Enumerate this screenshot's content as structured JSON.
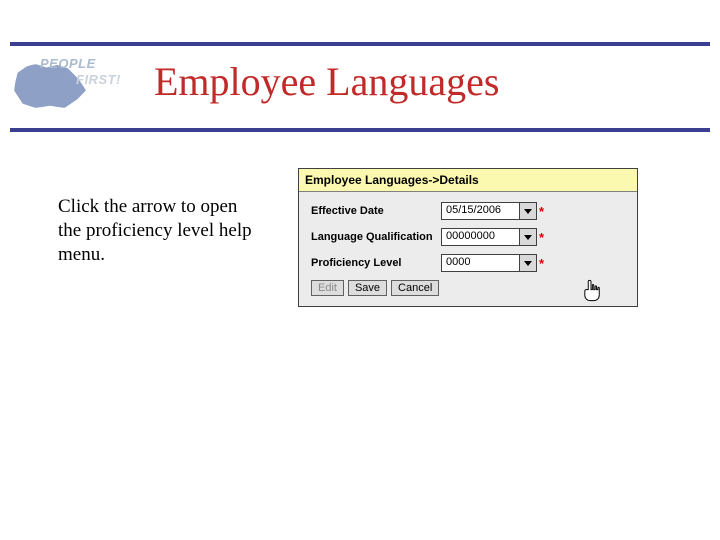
{
  "logo": {
    "line1": "PEOPLE",
    "line2": "FIRST!"
  },
  "title": "Employee Languages",
  "instruction": "Click the arrow to open the proficiency level help menu.",
  "panel": {
    "breadcrumb": "Employee Languages->Details",
    "rows": {
      "effective": {
        "label": "Effective Date",
        "value": "05/15/2006",
        "required": "*"
      },
      "langqual": {
        "label": "Language Qualification",
        "value": "00000000",
        "required": "*"
      },
      "proflvl": {
        "label": "Proficiency Level",
        "value": "0000",
        "required": "*"
      }
    },
    "buttons": {
      "edit": "Edit",
      "save": "Save",
      "cancel": "Cancel"
    }
  }
}
